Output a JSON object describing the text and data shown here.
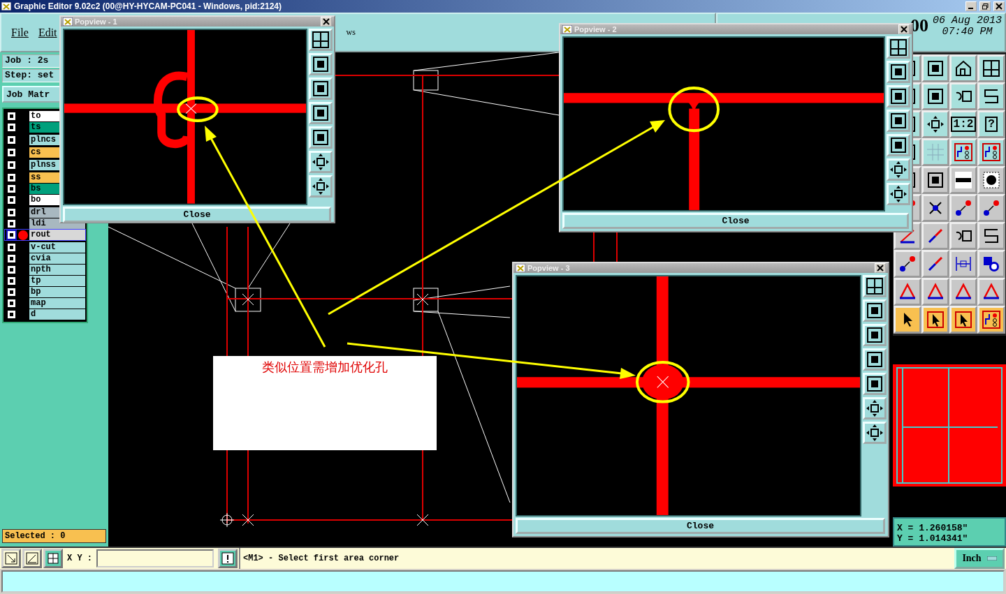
{
  "window": {
    "title": "Graphic Editor 9.02c2 (00@HY-HYCAM-PC041 - Windows, pid:2124)"
  },
  "menu": [
    "File",
    "Edit",
    "ws"
  ],
  "header": {
    "brand": "00",
    "date": "06 Aug 2013",
    "time": "07:40 PM"
  },
  "job": {
    "job_label": "Job : 2s",
    "step_label": "Step: set",
    "matrix_button": "Job Matr"
  },
  "layer_groups": [
    {
      "layers": [
        {
          "name": "to",
          "color": "#ffffff",
          "selected": false
        },
        {
          "name": "ts",
          "color": "#00a07c",
          "selected": false
        }
      ]
    },
    {
      "layers": [
        {
          "name": "plncs",
          "color": "#a0dcdc",
          "selected": false
        }
      ]
    },
    {
      "layers": [
        {
          "name": "cs",
          "color": "#f8c050",
          "selected": false
        }
      ]
    },
    {
      "layers": [
        {
          "name": "plnss",
          "color": "#a0dcdc",
          "selected": false
        }
      ]
    },
    {
      "layers": [
        {
          "name": "ss",
          "color": "#f8c050",
          "selected": false
        },
        {
          "name": "bs",
          "color": "#00a07c",
          "selected": false
        },
        {
          "name": "bo",
          "color": "#ffffff",
          "selected": false
        }
      ]
    },
    {
      "layers": [
        {
          "name": "drl",
          "color": "#a8b8c0",
          "selected": false
        },
        {
          "name": "ldi",
          "color": "#a8b8c0",
          "selected": false
        },
        {
          "name": "rout",
          "color": "#d8d8d8",
          "selected": true
        }
      ]
    },
    {
      "layers": [
        {
          "name": "v-cut",
          "color": "#a0dcdc",
          "selected": false
        },
        {
          "name": "cvia",
          "color": "#a0dcdc",
          "selected": false
        },
        {
          "name": "npth",
          "color": "#a0dcdc",
          "selected": false
        },
        {
          "name": "tp",
          "color": "#a0dcdc",
          "selected": false
        },
        {
          "name": "bp",
          "color": "#a0dcdc",
          "selected": false
        },
        {
          "name": "map",
          "color": "#a0dcdc",
          "selected": false
        },
        {
          "name": "d",
          "color": "#a0dcdc",
          "selected": false
        }
      ]
    }
  ],
  "selected_count": "Selected : 0",
  "note": "类似位置需增加优化孔",
  "tool_grid_labels": [
    "1:2",
    "?"
  ],
  "coordinates": {
    "x": "X = 1.260158\"",
    "y": "Y = 1.014341\""
  },
  "status": {
    "xy_label": "X Y :",
    "message": "<M1> - Select first area corner",
    "unit": "Inch"
  },
  "popviews": [
    {
      "title": "Popview - 1",
      "close": "Close"
    },
    {
      "title": "Popview - 2",
      "close": "Close"
    },
    {
      "title": "Popview - 3",
      "close": "Close"
    }
  ]
}
